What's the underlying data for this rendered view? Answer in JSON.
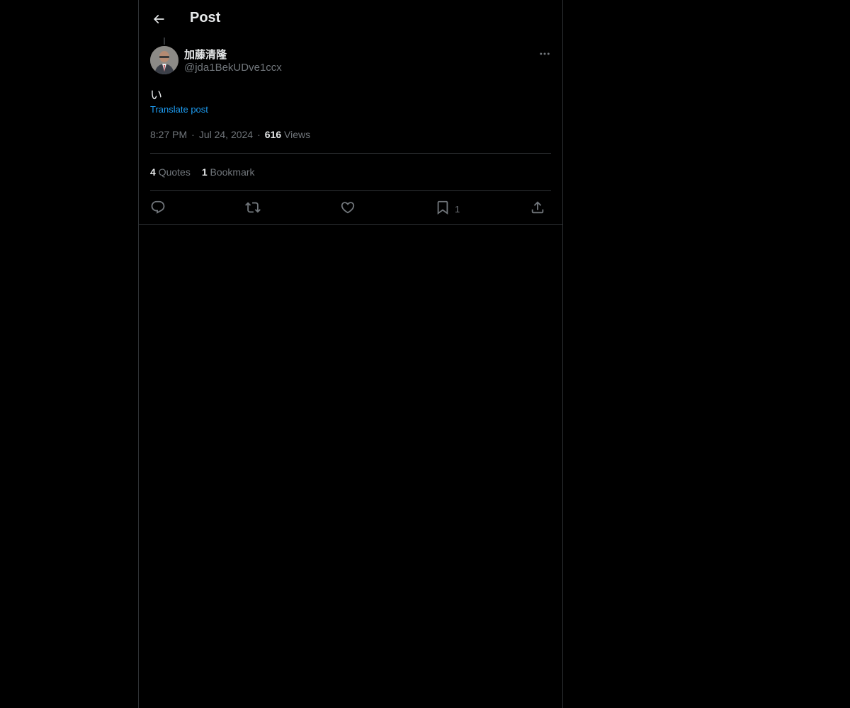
{
  "header": {
    "title": "Post"
  },
  "author": {
    "name": "加藤清隆",
    "handle": "@jda1BekUDve1ccx"
  },
  "post": {
    "text": "い",
    "translate_label": "Translate post",
    "time": "8:27 PM",
    "date": "Jul 24, 2024",
    "views_count": "616",
    "views_label": "Views"
  },
  "stats": {
    "quotes_count": "4",
    "quotes_label": "Quotes",
    "bookmarks_count": "1",
    "bookmarks_label": "Bookmark"
  },
  "actions": {
    "reply_icon": "reply-icon",
    "repost_icon": "repost-icon",
    "like_icon": "heart-icon",
    "bookmark_icon": "bookmark-icon",
    "bookmark_count": "1",
    "share_icon": "share-icon"
  },
  "colors": {
    "background": "#000000",
    "text": "#e7e9ea",
    "muted": "#71767b",
    "accent": "#1d9bf0",
    "border": "#2f3336"
  }
}
